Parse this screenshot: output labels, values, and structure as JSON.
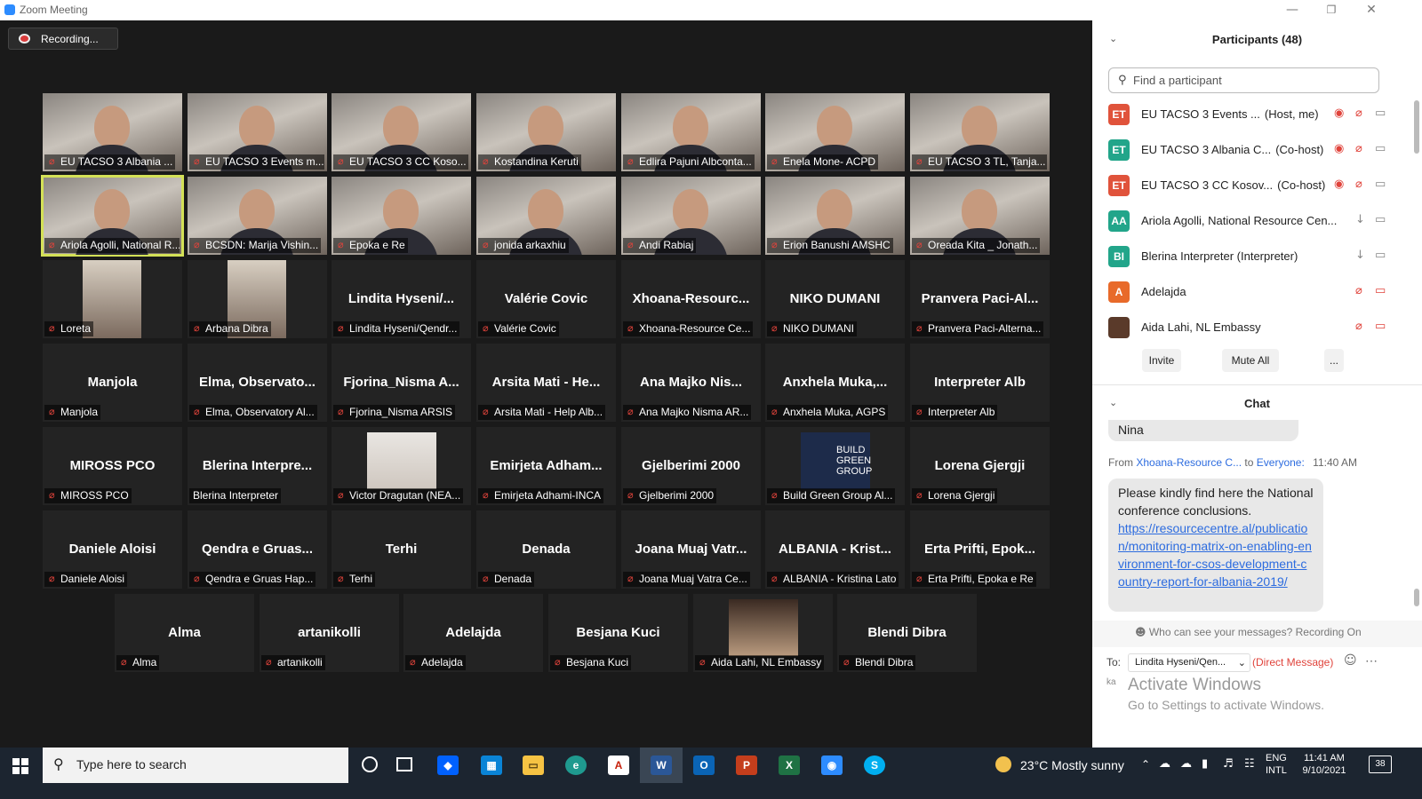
{
  "window": {
    "title": "Zoom Meeting"
  },
  "recording": {
    "label": "Recording..."
  },
  "tiles": [
    {
      "big": "",
      "label": "EU TACSO 3 Albania ...",
      "video": true
    },
    {
      "big": "",
      "label": "EU TACSO 3 Events m...",
      "video": true
    },
    {
      "big": "",
      "label": "EU TACSO 3 CC Koso...",
      "video": true
    },
    {
      "big": "",
      "label": "Kostandina Keruti",
      "video": true
    },
    {
      "big": "",
      "label": "Edlira Pajuni Albconta...",
      "video": true
    },
    {
      "big": "",
      "label": "Enela Mone- ACPD",
      "video": true
    },
    {
      "big": "",
      "label": "EU TACSO 3 TL, Tanja...",
      "video": true
    },
    {
      "big": "",
      "label": "Ariola Agolli, National R...",
      "video": true
    },
    {
      "big": "",
      "label": "BCSDN: Marija Vishin...",
      "video": true
    },
    {
      "big": "",
      "label": "Epoka e Re",
      "video": true
    },
    {
      "big": "",
      "label": "jonida arkaxhiu",
      "video": true
    },
    {
      "big": "",
      "label": "Andi Rabiaj",
      "video": true
    },
    {
      "big": "",
      "label": "Erion Banushi AMSHC",
      "video": true
    },
    {
      "big": "",
      "label": "Oreada Kita _ Jonath...",
      "video": true
    },
    {
      "big": "",
      "label": "Loreta",
      "video": false
    },
    {
      "big": "",
      "label": "Arbana Dibra",
      "video": false
    },
    {
      "big": "Lindita  Hyseni/...",
      "label": "Lindita Hyseni/Qendr...",
      "video": false
    },
    {
      "big": "Valérie Covic",
      "label": "Valérie Covic",
      "video": false
    },
    {
      "big": "Xhoana-Resourc...",
      "label": "Xhoana-Resource Ce...",
      "video": false
    },
    {
      "big": "NIKO DUMANI",
      "label": "NIKO DUMANI",
      "video": false
    },
    {
      "big": "Pranvera  Paci-Al...",
      "label": "Pranvera Paci-Alterna...",
      "video": false
    },
    {
      "big": "Manjola",
      "label": "Manjola",
      "video": false
    },
    {
      "big": "Elma,  Observato...",
      "label": "Elma, Observatory Al...",
      "video": false
    },
    {
      "big": "Fjorina_Nisma  A...",
      "label": "Fjorina_Nisma ARSIS",
      "video": false
    },
    {
      "big": "Arsita Mati - He...",
      "label": "Arsita Mati - Help Alb...",
      "video": false
    },
    {
      "big": "Ana Majko Nis...",
      "label": "Ana Majko Nisma AR...",
      "video": false
    },
    {
      "big": "Anxhela  Muka,...",
      "label": "Anxhela Muka, AGPS",
      "video": false
    },
    {
      "big": "Interpreter Alb",
      "label": "Interpreter Alb",
      "video": false
    },
    {
      "big": "MIROSS PCO",
      "label": "MIROSS PCO",
      "video": false
    },
    {
      "big": "Blerina  Interpre...",
      "label": "Blerina Interpreter",
      "video": false
    },
    {
      "big": "",
      "label": "Victor Dragutan (NEA...",
      "video": false
    },
    {
      "big": "Emirjeta  Adham...",
      "label": "Emirjeta Adhami-INCA",
      "video": false
    },
    {
      "big": "Gjelberimi 2000",
      "label": "Gjelberimi 2000",
      "video": false
    },
    {
      "big": "",
      "label": "Build Green Group Al...",
      "video": false
    },
    {
      "big": "Lorena Gjergji",
      "label": "Lorena Gjergji",
      "video": false
    },
    {
      "big": "Daniele Aloisi",
      "label": "Daniele Aloisi",
      "video": false
    },
    {
      "big": "Qendra e Gruas...",
      "label": "Qendra e Gruas Hap...",
      "video": false
    },
    {
      "big": "Terhi",
      "label": "Terhi",
      "video": false
    },
    {
      "big": "Denada",
      "label": "Denada",
      "video": false
    },
    {
      "big": "Joana Muaj Vatr...",
      "label": "Joana Muaj Vatra Ce...",
      "video": false
    },
    {
      "big": "ALBANIA - Krist...",
      "label": "ALBANIA - Kristina Lato",
      "video": false
    },
    {
      "big": "Erta  Prifti,  Epok...",
      "label": "Erta Prifti, Epoka e Re",
      "video": false
    },
    {
      "big": "Alma",
      "label": "Alma",
      "video": false
    },
    {
      "big": "artanikolli",
      "label": "artanikolli",
      "video": false
    },
    {
      "big": "Adelajda",
      "label": "Adelajda",
      "video": false
    },
    {
      "big": "Besjana Kuci",
      "label": "Besjana Kuci",
      "video": false
    },
    {
      "big": "",
      "label": "Aida Lahi, NL Embassy",
      "video": false
    },
    {
      "big": "Blendi Dibra",
      "label": "Blendi Dibra",
      "video": false
    }
  ],
  "build_green_logo": {
    "line1": "BUILD",
    "line2": "GREEN",
    "line3": "GROUP"
  },
  "participants": {
    "header": "Participants (48)",
    "search_placeholder": "Find a participant",
    "list": [
      {
        "initials": "ET",
        "name": "EU TACSO 3 Events ...",
        "role": "(Host, me)",
        "color": "#e0533b"
      },
      {
        "initials": "ET",
        "name": "EU TACSO 3 Albania C...",
        "role": "(Co-host)",
        "color": "#22a58a"
      },
      {
        "initials": "ET",
        "name": "EU TACSO 3 CC Kosov...",
        "role": "(Co-host)",
        "color": "#e0533b"
      },
      {
        "initials": "AA",
        "name": "Ariola Agolli, National Resource Cen...",
        "role": "",
        "color": "#22a58a"
      },
      {
        "initials": "BI",
        "name": "Blerina Interpreter (Interpreter)",
        "role": "",
        "color": "#22a58a"
      },
      {
        "initials": "A",
        "name": "Adelajda",
        "role": "",
        "color": "#e86a2a"
      },
      {
        "initials": "",
        "name": "Aida Lahi, NL Embassy",
        "role": "",
        "color": "#5a3a2a"
      }
    ],
    "buttons": {
      "invite": "Invite",
      "mute_all": "Mute All",
      "more": "..."
    }
  },
  "chat": {
    "header": "Chat",
    "prev_message": "Nina",
    "from_label": "From",
    "from_name": "Xhoana-Resource C...",
    "to_label": "to",
    "to_name": "Everyone:",
    "time": "11:40 AM",
    "message_text": "Please kindly find here the National conference conclusions.",
    "message_link": "https://resourcecentre.al/publication/monitoring-matrix-on-enabling-environment-for-csos-development-country-report-for-albania-2019/",
    "visibility": "Who can see your messages? Recording On",
    "to_field_label": "To:",
    "recipient": "Lindita Hyseni/Qen...",
    "direct_message": "(Direct Message)",
    "input_hint": "ka",
    "activate_title": "Activate Windows",
    "activate_sub": "Go to Settings to activate Windows."
  },
  "taskbar": {
    "search_placeholder": "Type here to search",
    "weather": "23°C  Mostly sunny",
    "lang1": "ENG",
    "lang2": "INTL",
    "time": "11:41 AM",
    "date": "9/10/2021",
    "notifications": "38"
  }
}
